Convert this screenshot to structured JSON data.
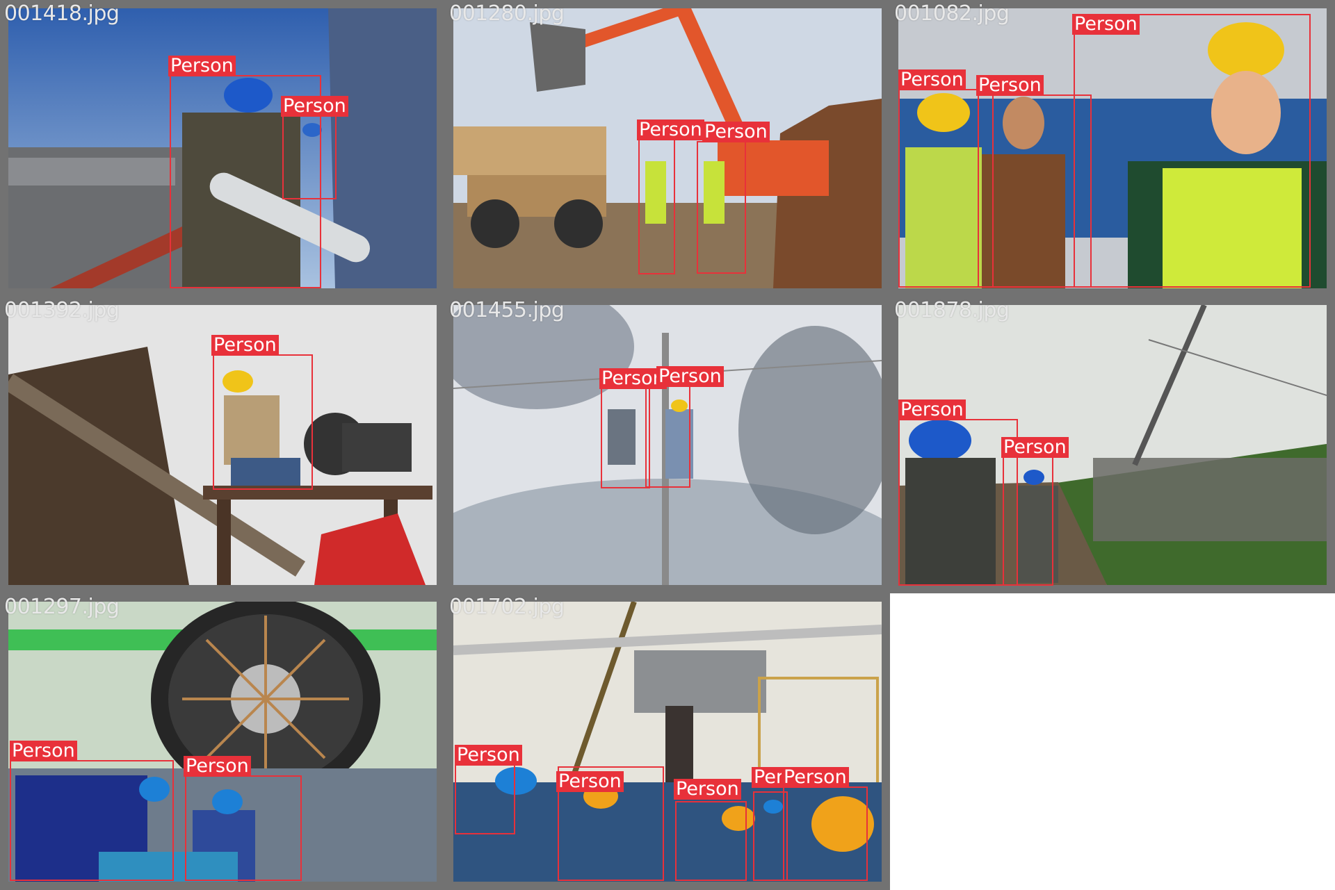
{
  "tiles": [
    {
      "filename": "001418.jpg",
      "label": "Person",
      "sky": "#3f6fb5",
      "ground": "#5d5a57"
    },
    {
      "filename": "001280.jpg",
      "label": "Person",
      "sky": "#c9d4e2",
      "ground": "#8a6a4c"
    },
    {
      "filename": "001082.jpg",
      "label": "Person",
      "sky": "#cfd3d8",
      "ground": "#2b5d9b"
    },
    {
      "filename": "001392.jpg",
      "label": "Person",
      "sky": "#e6e6e6",
      "ground": "#5b4636"
    },
    {
      "filename": "001455.jpg",
      "label": "Person",
      "sky": "#d8dce2",
      "ground": "#b9c0c8"
    },
    {
      "filename": "001878.jpg",
      "label": "Person",
      "sky": "#dde0dc",
      "ground": "#4b6b3a"
    },
    {
      "filename": "001297.jpg",
      "label": "Person",
      "sky": "#bcd6b8",
      "ground": "#2e3e7a"
    },
    {
      "filename": "001702.jpg",
      "label": "Person",
      "sky": "#e4e2da",
      "ground": "#3d4f6d"
    }
  ],
  "colors": {
    "frame": "#727272",
    "box": "#e8313a",
    "filename_text": "#e8e8e8"
  }
}
